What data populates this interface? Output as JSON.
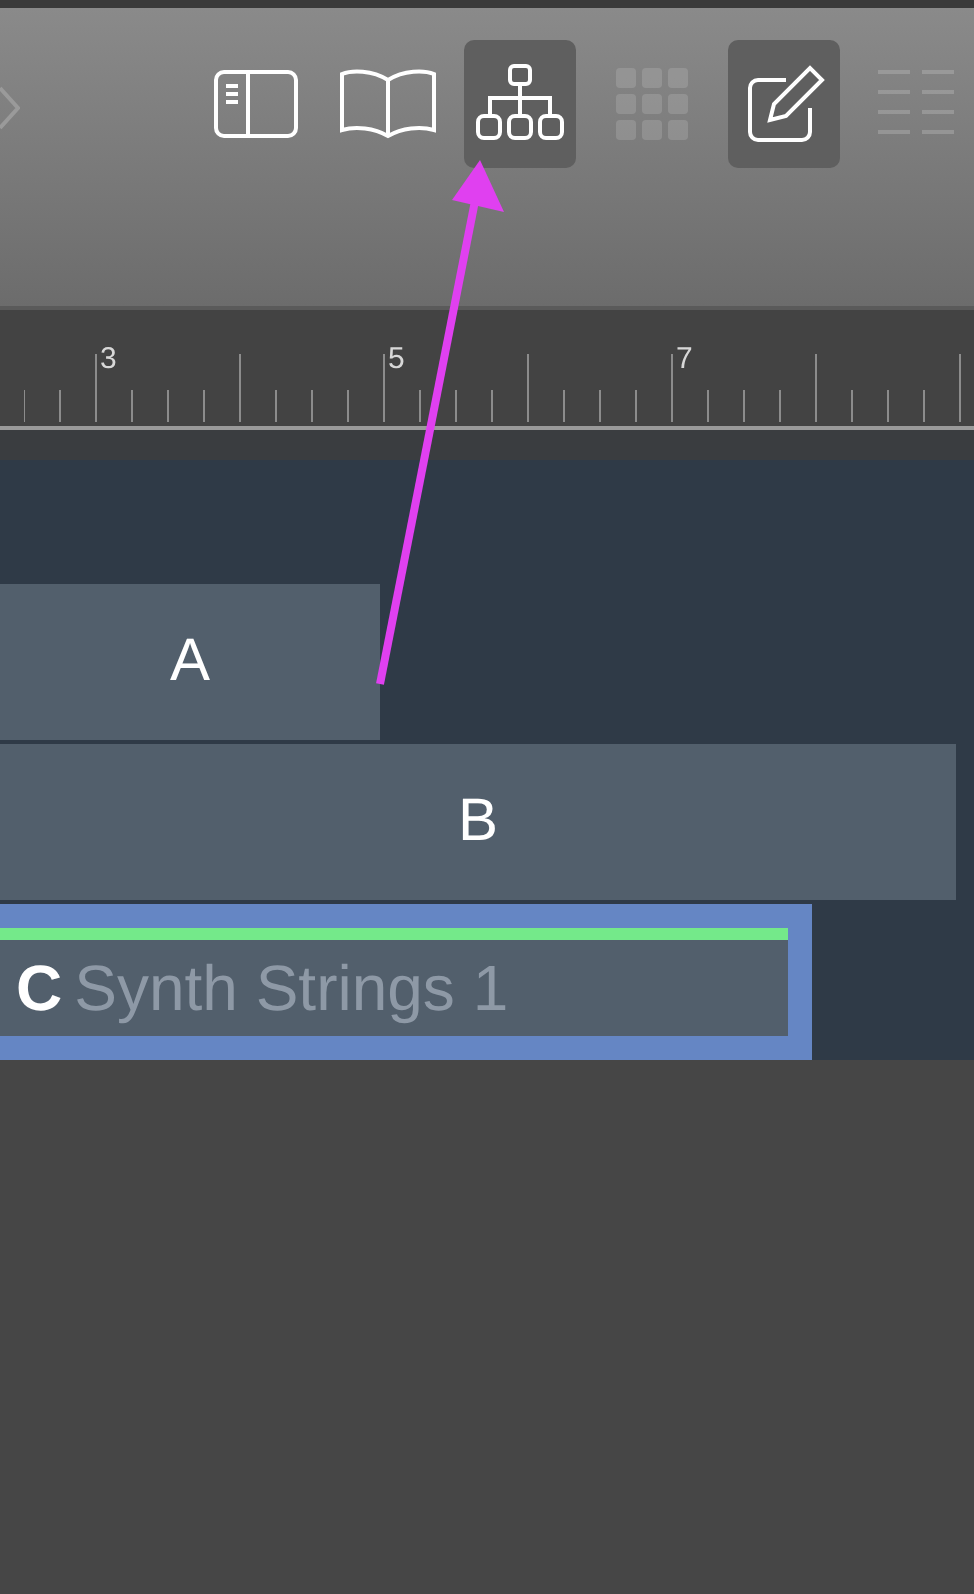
{
  "toolbar": {
    "buttons": [
      {
        "kind": "sidebar",
        "selected": false,
        "disabled": false
      },
      {
        "kind": "book",
        "selected": false,
        "disabled": false
      },
      {
        "kind": "hierarchy",
        "selected": true,
        "disabled": false
      },
      {
        "kind": "grid",
        "selected": false,
        "disabled": true
      },
      {
        "kind": "edit",
        "selected": true,
        "disabled": false
      },
      {
        "kind": "list",
        "selected": false,
        "disabled": true
      }
    ]
  },
  "ruler": {
    "labels": [
      "3",
      "5",
      "7"
    ]
  },
  "regions": [
    {
      "label": "A",
      "selected": false
    },
    {
      "label": "B",
      "selected": false
    },
    {
      "label": "C",
      "name": "Synth Strings 1",
      "selected": true
    }
  ],
  "annotation": {
    "kind": "arrow"
  }
}
